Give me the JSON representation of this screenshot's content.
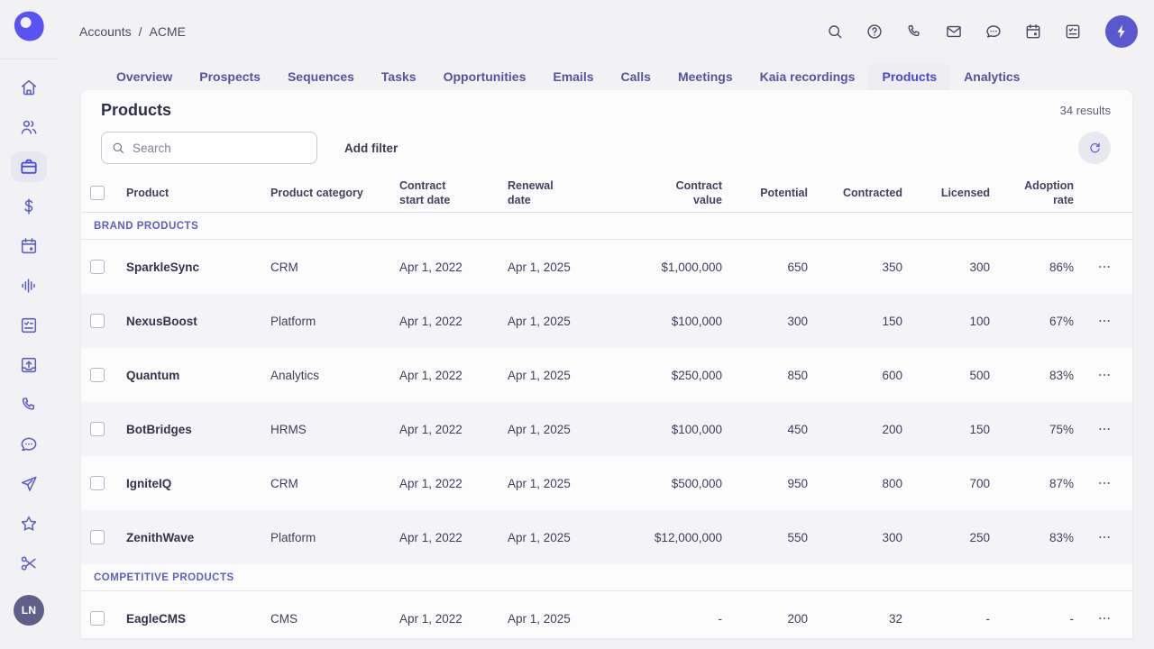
{
  "colors": {
    "accent": "#5952f5",
    "active_tab_text": "#4b48d6",
    "section_label": "#5f5ec9",
    "fab_bg": "#5a58cf",
    "avatar_bg": "#5f5f87",
    "row_alt_bg": "#f4f4f8"
  },
  "breadcrumb": {
    "parent": "Accounts",
    "separator": "/",
    "current": "ACME"
  },
  "topbar": {
    "icons": [
      "search-icon",
      "help-icon",
      "phone-icon",
      "mail-icon",
      "chat-icon",
      "calendar-icon",
      "tasks-icon"
    ],
    "fab_icon": "lightning-bolt-icon"
  },
  "sidebar": {
    "items": [
      "home",
      "prospects",
      "accounts",
      "opportunities",
      "calendar",
      "kaia-recordings",
      "tasks",
      "outbox",
      "calls",
      "conversations",
      "sequences",
      "favorites",
      "snippets"
    ],
    "active_item": "accounts",
    "avatar_initials": "LN"
  },
  "tabs": {
    "items": [
      {
        "label": "Overview",
        "active": false
      },
      {
        "label": "Prospects",
        "active": false
      },
      {
        "label": "Sequences",
        "active": false
      },
      {
        "label": "Tasks",
        "active": false
      },
      {
        "label": "Opportunities",
        "active": false
      },
      {
        "label": "Emails",
        "active": false
      },
      {
        "label": "Calls",
        "active": false
      },
      {
        "label": "Meetings",
        "active": false
      },
      {
        "label": "Kaia recordings",
        "active": false
      },
      {
        "label": "Products",
        "active": true
      },
      {
        "label": "Analytics",
        "active": false
      }
    ]
  },
  "panel": {
    "title": "Products",
    "results_count": "34 results",
    "search_placeholder": "Search",
    "search_value": "",
    "add_filter_label": "Add filter"
  },
  "table": {
    "headers": [
      "Product",
      "Product category",
      "Contract\nstart date",
      "Renewal\ndate",
      "Contract\nvalue",
      "Potential",
      "Contracted",
      "Licensed",
      "Adoption\nrate"
    ],
    "groups": [
      {
        "label": "BRAND PRODUCTS",
        "rows": [
          {
            "product": "SparkleSync",
            "cells": [
              "CRM",
              "Apr 1, 2022",
              "Apr 1, 2025",
              "$1,000,000",
              "650",
              "350",
              "300",
              "86%"
            ]
          },
          {
            "product": "NexusBoost",
            "cells": [
              "Platform",
              "Apr 1, 2022",
              "Apr 1, 2025",
              "$100,000",
              "300",
              "150",
              "100",
              "67%"
            ]
          },
          {
            "product": "Quantum",
            "cells": [
              "Analytics",
              "Apr 1, 2022",
              "Apr 1, 2025",
              "$250,000",
              "850",
              "600",
              "500",
              "83%"
            ]
          },
          {
            "product": "BotBridges",
            "cells": [
              "HRMS",
              "Apr 1, 2022",
              "Apr 1, 2025",
              "$100,000",
              "450",
              "200",
              "150",
              "75%"
            ]
          },
          {
            "product": "IgniteIQ",
            "cells": [
              "CRM",
              "Apr 1, 2022",
              "Apr 1, 2025",
              "$500,000",
              "950",
              "800",
              "700",
              "87%"
            ]
          },
          {
            "product": "ZenithWave",
            "cells": [
              "Platform",
              "Apr 1, 2022",
              "Apr 1, 2025",
              "$12,000,000",
              "550",
              "300",
              "250",
              "83%"
            ]
          }
        ]
      },
      {
        "label": "COMPETITIVE PRODUCTS",
        "rows": [
          {
            "product": "EagleCMS",
            "cells": [
              "CMS",
              "Apr 1, 2022",
              "Apr 1, 2025",
              "-",
              "200",
              "32",
              "-",
              "-"
            ]
          }
        ]
      }
    ]
  }
}
